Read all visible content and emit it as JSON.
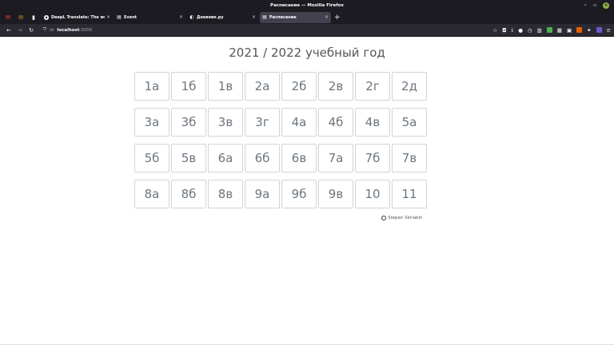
{
  "window": {
    "title": "Расписание — Mozilla Firefox"
  },
  "tabs": [
    {
      "label": "DeepL Translate: The world",
      "active": false,
      "favicon": "deepl-icon"
    },
    {
      "label": "Event",
      "active": false,
      "favicon": "document-icon"
    },
    {
      "label": "Дневник.ру",
      "active": false,
      "favicon": "dnevnik-icon"
    },
    {
      "label": "Расписание",
      "active": true,
      "favicon": "document-icon"
    }
  ],
  "url": {
    "host": "localhost",
    "port": ":5000"
  },
  "page": {
    "heading": "2021 / 2022 учебный год",
    "classes": [
      "1а",
      "1б",
      "1в",
      "2а",
      "2б",
      "2в",
      "2г",
      "2д",
      "3а",
      "3б",
      "3в",
      "3г",
      "4а",
      "4б",
      "4в",
      "5а",
      "5б",
      "5в",
      "6а",
      "6б",
      "6в",
      "7а",
      "7б",
      "7в",
      "8а",
      "8б",
      "8в",
      "9а",
      "9б",
      "9в",
      "10",
      "11"
    ],
    "credit": "Stepan Skriabin"
  },
  "colors": {
    "chrome": "#1c1b22",
    "active_tab": "#42414d",
    "button_text": "#6c757d"
  }
}
